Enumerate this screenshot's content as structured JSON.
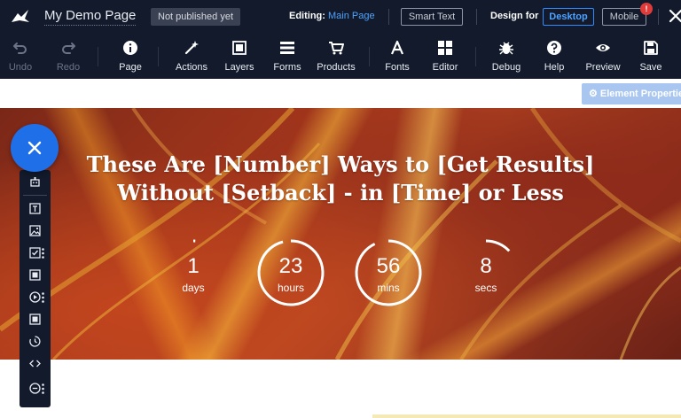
{
  "header": {
    "site_title": "My Demo Page",
    "publish_status": "Not published yet",
    "editing_label": "Editing:",
    "editing_page": "Main Page",
    "smart_text_label": "Smart Text",
    "design_for_label": "Design for",
    "desktop_label": "Desktop",
    "mobile_label": "Mobile",
    "notification_mark": "!"
  },
  "toolbar": {
    "items": [
      {
        "label": "Undo",
        "icon": "undo-icon",
        "enabled": false
      },
      {
        "label": "Redo",
        "icon": "redo-icon",
        "enabled": false
      },
      {
        "label": "Page",
        "icon": "info-icon",
        "enabled": true
      },
      {
        "label": "Actions",
        "icon": "magic-wand-icon",
        "enabled": true
      },
      {
        "label": "Layers",
        "icon": "layers-icon",
        "enabled": true
      },
      {
        "label": "Forms",
        "icon": "list-icon",
        "enabled": true
      },
      {
        "label": "Products",
        "icon": "cart-icon",
        "enabled": true
      },
      {
        "label": "Fonts",
        "icon": "font-icon",
        "enabled": true
      },
      {
        "label": "Editor",
        "icon": "grid-icon",
        "enabled": true
      },
      {
        "label": "Debug",
        "icon": "bug-icon",
        "enabled": true
      },
      {
        "label": "Help",
        "icon": "question-icon",
        "enabled": true
      },
      {
        "label": "Preview",
        "icon": "eye-icon",
        "enabled": true
      },
      {
        "label": "Save",
        "icon": "floppy-icon",
        "enabled": true
      }
    ]
  },
  "element_properties_label": "⚙ Element Properties",
  "hero": {
    "title_line1": "These Are [Number] Ways to [Get Results]",
    "title_line2": "Without [Setback] - in [Time] or Less",
    "countdown": [
      {
        "value": "1",
        "unit": "days",
        "progress": 0.01
      },
      {
        "value": "23",
        "unit": "hours",
        "progress": 0.96
      },
      {
        "value": "56",
        "unit": "mins",
        "progress": 0.93
      },
      {
        "value": "8",
        "unit": "secs",
        "progress": 0.13
      }
    ]
  },
  "side_panel": {
    "items": [
      "robot-icon",
      "text-box-icon",
      "image-icon",
      "checkbox-icon",
      "section-icon",
      "play-icon",
      "section-icon",
      "timer-icon",
      "code-icon",
      "more-icon"
    ]
  },
  "colors": {
    "chrome_bg": "#121a2b",
    "accent_blue": "#1f6fe8",
    "link_blue": "#4da3ff",
    "hero_base": "#a8391c",
    "alert_red": "#e03b3b"
  }
}
